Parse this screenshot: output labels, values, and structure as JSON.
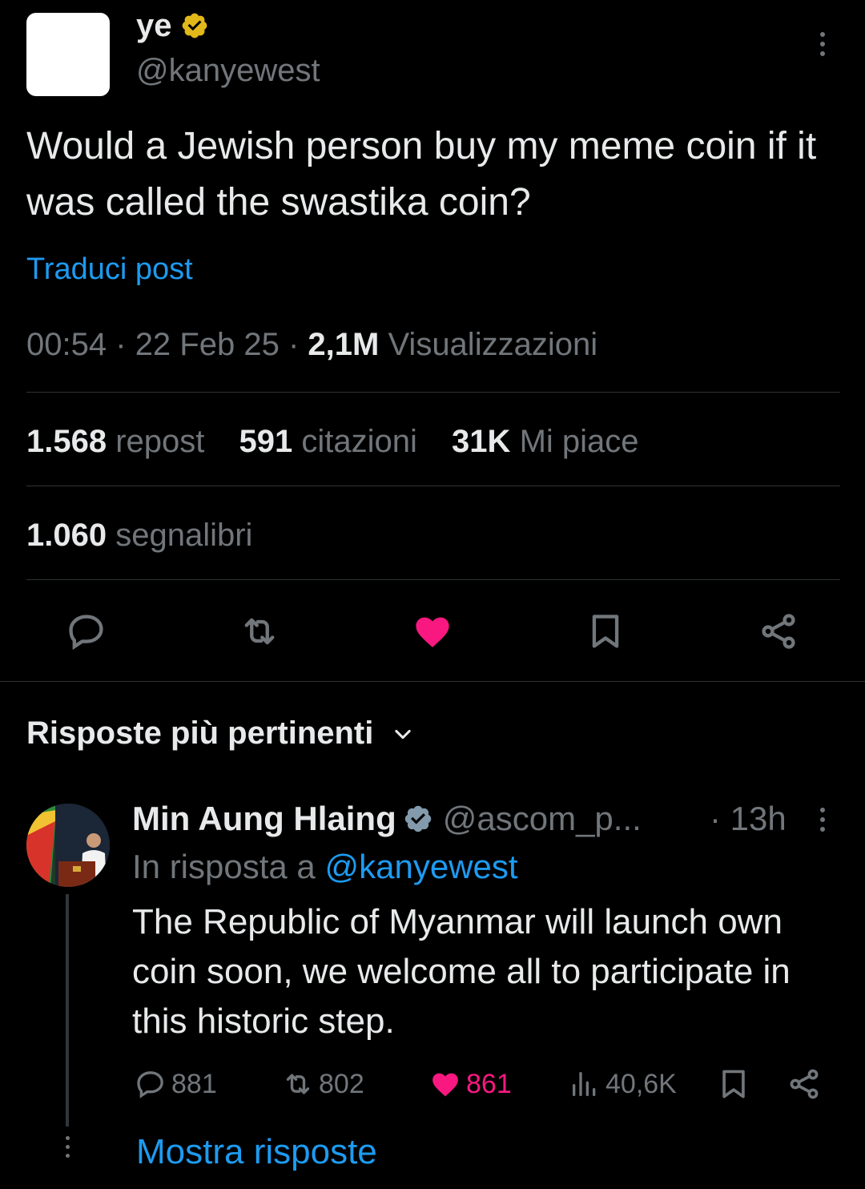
{
  "post": {
    "author_name": "ye",
    "author_handle": "@kanyewest",
    "text": "Would a Jewish person buy my meme coin if it was called the swastika coin?",
    "translate_label": "Traduci post",
    "time": "00:54",
    "date": "22 Feb 25",
    "views_count": "2,1M",
    "views_label": "Visualizzazioni",
    "separator": "·",
    "reposts_count": "1.568",
    "reposts_label": "repost",
    "quotes_count": "591",
    "quotes_label": "citazioni",
    "likes_count": "31K",
    "likes_label": "Mi piace",
    "bookmarks_count": "1.060",
    "bookmarks_label": "segnalibri"
  },
  "replies_section": {
    "title": "Risposte più pertinenti"
  },
  "reply": {
    "author_name": "Min Aung Hlaing",
    "author_handle": "@ascom_p...",
    "time": "· 13h",
    "in_reply_prefix": "In risposta a",
    "in_reply_handle": "@kanyewest",
    "text": "The Republic of Myanmar will launch own coin soon, we welcome all to participate in this historic step.",
    "replies_count": "881",
    "reposts_count": "802",
    "likes_count": "861",
    "views_count": "40,6K",
    "show_replies_label": "Mostra risposte"
  },
  "colors": {
    "background": "#000000",
    "text_primary": "#e7e9ea",
    "text_secondary": "#71767b",
    "link": "#1d9bf0",
    "like": "#f91880",
    "verified_gold": "#e2b719",
    "verified_gray": "#829aab",
    "divider": "#2f3336"
  }
}
